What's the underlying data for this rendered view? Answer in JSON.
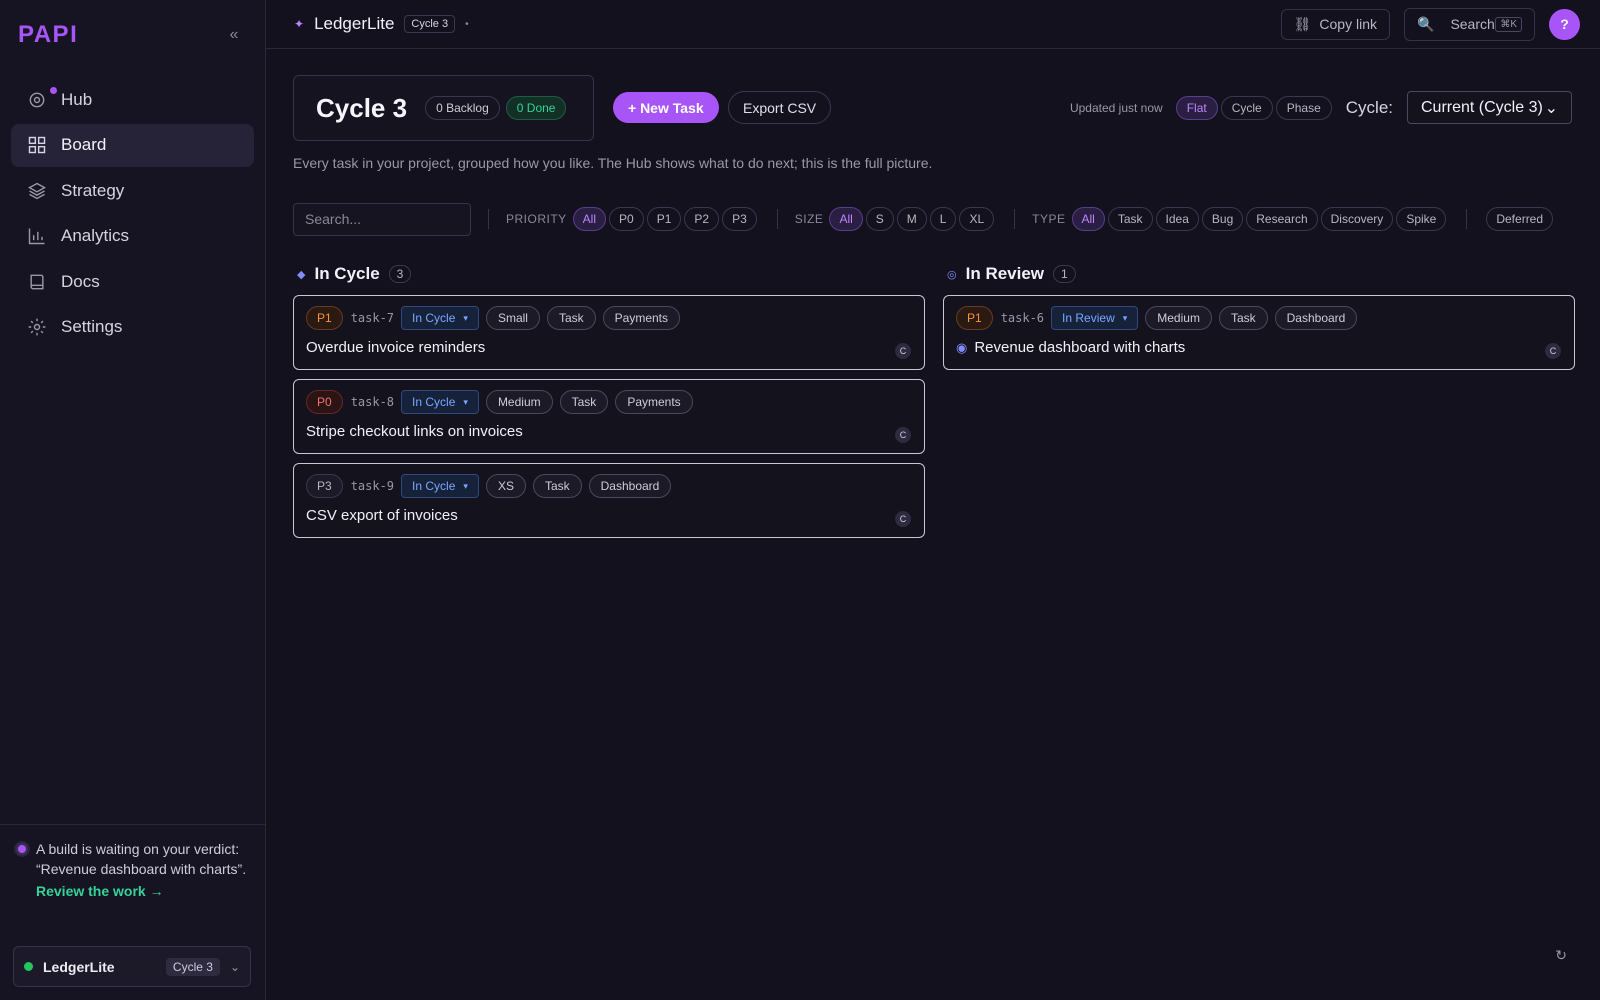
{
  "sidebar": {
    "logo": "PAPI",
    "collapse_icon": "«",
    "items": [
      {
        "label": "Hub",
        "icon": "hub-icon"
      },
      {
        "label": "Board",
        "icon": "board-icon",
        "active": true
      },
      {
        "label": "Strategy",
        "icon": "layers-icon"
      },
      {
        "label": "Analytics",
        "icon": "analytics-icon"
      },
      {
        "label": "Docs",
        "icon": "book-icon"
      },
      {
        "label": "Settings",
        "icon": "settings-icon"
      }
    ],
    "verdict_text": "A build is waiting on your verdict: “Revenue dashboard with charts”.",
    "verdict_link": "Review the work →",
    "project": {
      "name": "LedgerLite",
      "cycle": "Cycle 3"
    }
  },
  "topbar": {
    "title": "LedgerLite",
    "cycle_badge": "Cycle 3",
    "mini": "•",
    "copy_link": "Copy link",
    "search": "Search",
    "search_kbd": "⌘K",
    "help": "?"
  },
  "header": {
    "cycle_title": "Cycle 3",
    "backlog": "0 Backlog",
    "done": "0 Done",
    "new_task": "+ New Task",
    "export": "Export CSV",
    "updated": "Updated just now",
    "views": [
      "Flat",
      "Cycle",
      "Phase"
    ],
    "cycle_label": "Cycle:",
    "cycle_select": "Current (Cycle 3)"
  },
  "subtitle": "Every task in your project, grouped how you like. The Hub shows what to do next; this is the full picture.",
  "filters": {
    "search_placeholder": "Search...",
    "priority_label": "PRIORITY",
    "priority": [
      "All",
      "P0",
      "P1",
      "P2",
      "P3"
    ],
    "size_label": "SIZE",
    "size": [
      "All",
      "S",
      "M",
      "L",
      "XL"
    ],
    "type_label": "TYPE",
    "type": [
      "All",
      "Task",
      "Idea",
      "Bug",
      "Research",
      "Discovery",
      "Spike"
    ],
    "deferred": "Deferred"
  },
  "columns": [
    {
      "title": "In Cycle",
      "count": "3",
      "cards": [
        {
          "priority": "P1",
          "id": "task-7",
          "status": "In Cycle",
          "size": "Small",
          "type": "Task",
          "area": "Payments",
          "title": "Overdue invoice reminders",
          "badge": "C"
        },
        {
          "priority": "P0",
          "id": "task-8",
          "status": "In Cycle",
          "size": "Medium",
          "type": "Task",
          "area": "Payments",
          "title": "Stripe checkout links on invoices",
          "badge": "C"
        },
        {
          "priority": "P3",
          "id": "task-9",
          "status": "In Cycle",
          "size": "XS",
          "type": "Task",
          "area": "Dashboard",
          "title": "CSV export of invoices",
          "badge": "C"
        }
      ]
    },
    {
      "title": "In Review",
      "count": "1",
      "cards": [
        {
          "priority": "P1",
          "id": "task-6",
          "status": "In Review",
          "size": "Medium",
          "type": "Task",
          "area": "Dashboard",
          "title": "Revenue dashboard with charts",
          "badge": "C"
        }
      ]
    }
  ],
  "refresh_icon": "↻"
}
